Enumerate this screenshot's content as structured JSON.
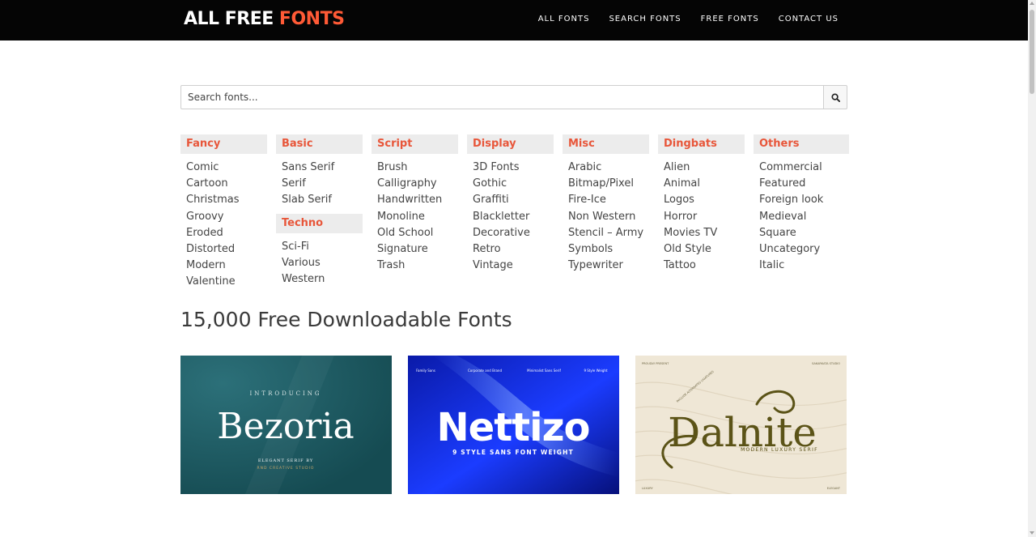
{
  "logo": {
    "part1": "ALL FREE",
    "part2": "FONTS"
  },
  "nav": [
    "ALL FONTS",
    "SEARCH FONTS",
    "FREE FONTS",
    "CONTACT US"
  ],
  "search": {
    "placeholder": "Search fonts...",
    "icon": "search-icon"
  },
  "categories": [
    {
      "title": "Fancy",
      "items": [
        "Comic",
        "Cartoon",
        "Christmas",
        "Groovy",
        "Eroded",
        "Distorted",
        "Modern",
        "Valentine"
      ]
    },
    {
      "title": "Basic",
      "items": [
        "Sans Serif",
        "Serif",
        "Slab Serif"
      ],
      "sub_title": "Techno",
      "sub_items": [
        "Sci-Fi",
        "Various",
        "Western"
      ]
    },
    {
      "title": "Script",
      "items": [
        "Brush",
        "Calligraphy",
        "Handwritten",
        "Monoline",
        "Old School",
        "Signature",
        "Trash"
      ]
    },
    {
      "title": "Display",
      "items": [
        "3D Fonts",
        "Gothic",
        "Graffiti",
        "Blackletter",
        "Decorative",
        "Retro",
        "Vintage"
      ]
    },
    {
      "title": "Misc",
      "items": [
        "Arabic",
        "Bitmap/Pixel",
        "Fire-Ice",
        "Non Western",
        "Stencil – Army",
        "Symbols",
        "Typewriter"
      ]
    },
    {
      "title": "Dingbats",
      "items": [
        "Alien",
        "Animal",
        "Logos",
        "Horror",
        "Movies TV",
        "Old Style",
        "Tattoo"
      ]
    },
    {
      "title": "Others",
      "items": [
        "Commercial",
        "Featured",
        "Foreign look",
        "Medieval",
        "Square",
        "Uncategory",
        "Italic"
      ]
    }
  ],
  "heading": "15,000 Free Downloadable Fonts",
  "cards": [
    {
      "name": "Bezoria",
      "intro": "INTRODUCING",
      "tagline": "ELEGANT SERIF BY",
      "credit": "RND CREATIVE STUDIO",
      "bg": "#1d5a62",
      "text_color": "#ffffff",
      "accent": "#c9a86a"
    },
    {
      "name": "Nettizo",
      "tagline": "9 STYLE SANS FONT WEIGHT",
      "features": [
        "Family Sans",
        "Corporate and Brand",
        "Minimalist Sans Serif",
        "9 Style Weight"
      ],
      "bg": "#0a1fcf",
      "text_color": "#ffffff"
    },
    {
      "name": "Dalnite",
      "tagline": "MODERN LUXURY SERIF",
      "top_left": "PROUDLY PRESENT",
      "top_right": "SAKARKATA STUDIO",
      "badge": "INCLUDE ALTERNATES LIGATURES",
      "bottom_left": "LUXURY",
      "bottom_right": "ELEGANT",
      "bg": "#efe7d6",
      "text_color": "#5b5317"
    }
  ],
  "colors": {
    "accent": "#ff5a36",
    "category_title": "#e8563a",
    "topbar": "#050505"
  }
}
